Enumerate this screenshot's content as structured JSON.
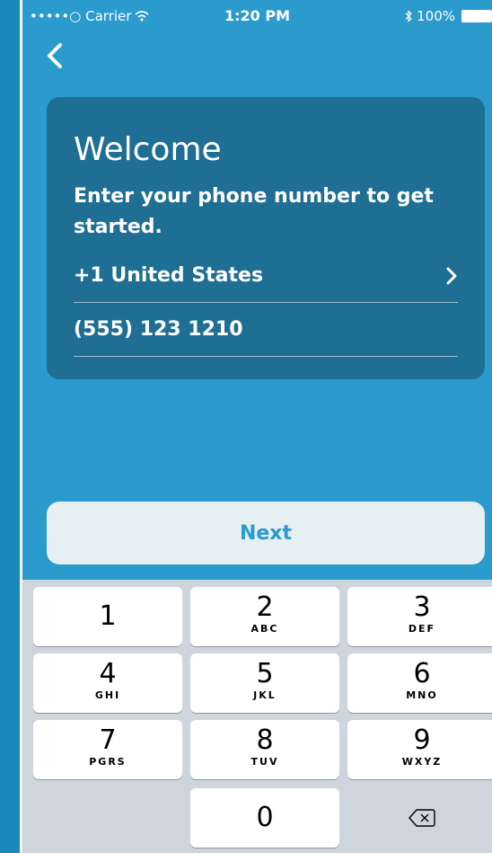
{
  "status_bar": {
    "carrier": "•••••○ Carrier",
    "time": "1:20 PM",
    "battery": "100%"
  },
  "card": {
    "title": "Welcome",
    "subtitle": "Enter your phone number to get started.",
    "country": "+1 United States",
    "phone": "(555) 123 1210"
  },
  "actions": {
    "next": "Next"
  },
  "keypad": {
    "keys": [
      {
        "digit": "1",
        "letters": ""
      },
      {
        "digit": "2",
        "letters": "ABC"
      },
      {
        "digit": "3",
        "letters": "DEF"
      },
      {
        "digit": "4",
        "letters": "GHI"
      },
      {
        "digit": "5",
        "letters": "JKL"
      },
      {
        "digit": "6",
        "letters": "MNO"
      },
      {
        "digit": "7",
        "letters": "PGRS"
      },
      {
        "digit": "8",
        "letters": "TUV"
      },
      {
        "digit": "9",
        "letters": "WXYZ"
      },
      {
        "digit": "0",
        "letters": ""
      }
    ]
  },
  "colors": {
    "background": "#2a9bcc",
    "card": "#1e6f93",
    "button": "#e6eff2",
    "keyboard": "#cfd5dc"
  },
  "icons": [
    "wifi-icon",
    "bluetooth-icon",
    "battery-icon",
    "back-chevron-icon",
    "chevron-right-icon",
    "backspace-icon"
  ]
}
